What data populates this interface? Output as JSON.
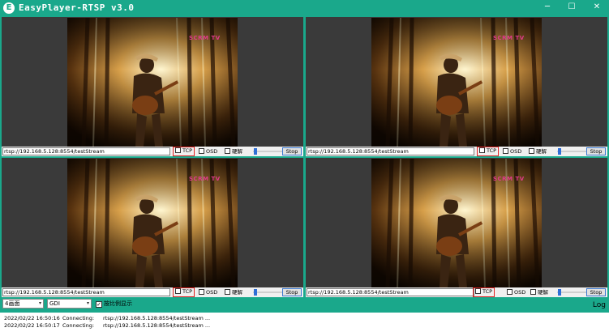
{
  "window": {
    "icon_letter": "E",
    "title": "EasyPlayer-RTSP v3.0",
    "minimize": "─",
    "maximize": "☐",
    "close": "✕",
    "accent": "#1aa88b"
  },
  "panes": [
    {
      "url": "rtsp://192.168.5.128:8554/testStream",
      "tcp": "TCP",
      "osd": "OSD",
      "hw": "硬解",
      "stop": "Stop",
      "watermark": "SCRM TV"
    },
    {
      "url": "rtsp://192.168.5.128:8554/testStream",
      "tcp": "TCP",
      "osd": "OSD",
      "hw": "硬解",
      "stop": "Stop",
      "watermark": "SCRM TV"
    },
    {
      "url": "rtsp://192.168.5.128:8554/testStream",
      "tcp": "TCP",
      "osd": "OSD",
      "hw": "硬解",
      "stop": "Stop",
      "watermark": "SCRM TV"
    },
    {
      "url": "rtsp://192.168.5.128:8554/testStream",
      "tcp": "TCP",
      "osd": "OSD",
      "hw": "硬解",
      "stop": "Stop",
      "watermark": "SCRM TV"
    }
  ],
  "controls": {
    "layout_select": "4画面",
    "render_select": "GDI",
    "ratio_label": "按比例显示",
    "ratio_checked": "✓",
    "log_label": "Log"
  },
  "log": [
    {
      "timestamp": "2022/02/22 16:50:16",
      "status": "Connecting:",
      "url": "rtsp://192.168.5.128:8554/testStream ..."
    },
    {
      "timestamp": "2022/02/22 16:50:17",
      "status": "Connecting:",
      "url": "rtsp://192.168.5.128:8554/testStream ..."
    }
  ]
}
